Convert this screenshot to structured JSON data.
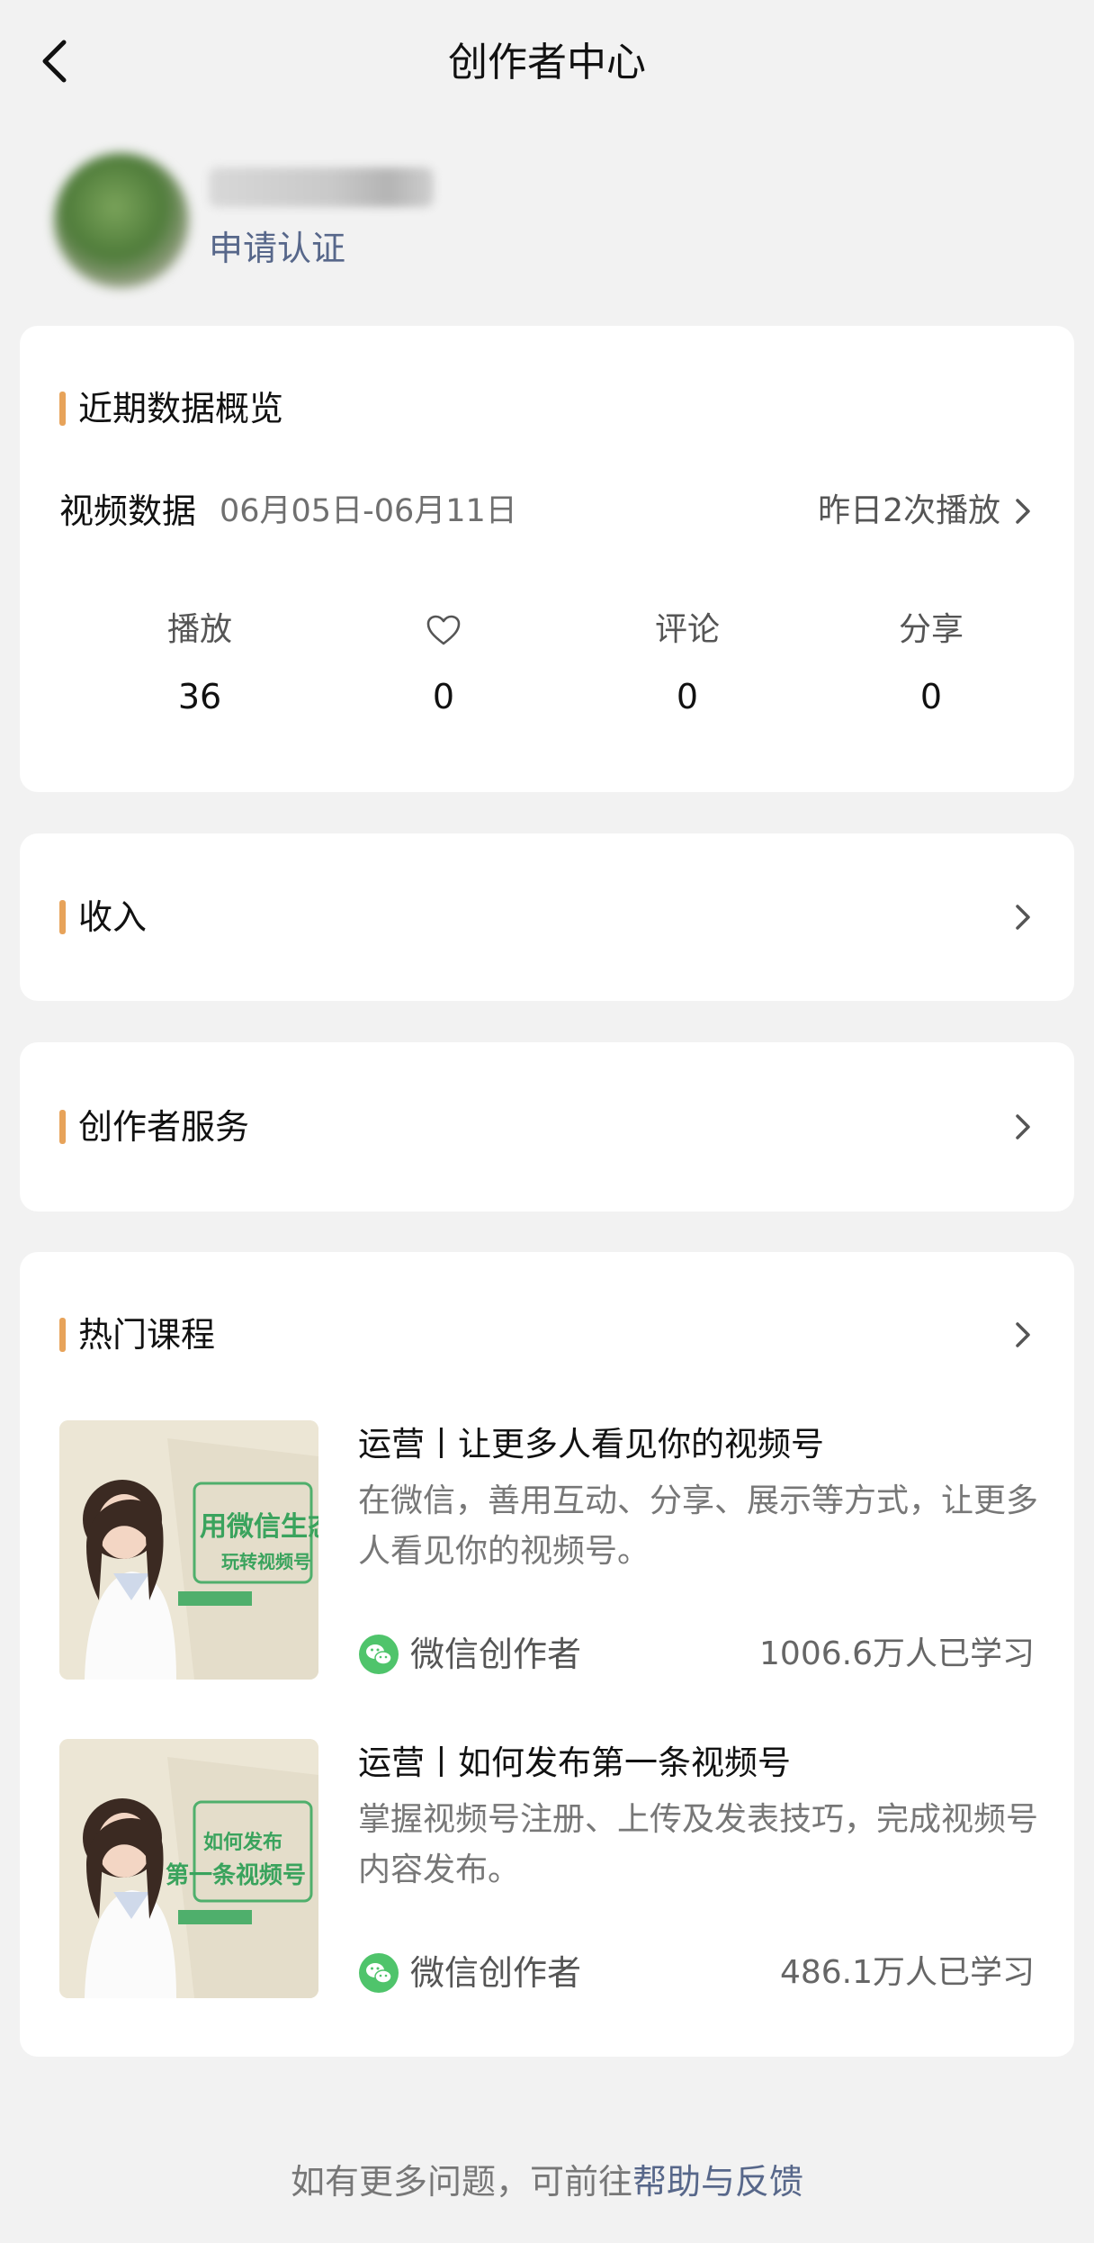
{
  "header": {
    "title": "创作者中心"
  },
  "profile": {
    "apply_cert": "申请认证"
  },
  "overview": {
    "title": "近期数据概览",
    "data_label": "视频数据",
    "date_range": "06月05日-06月11日",
    "yesterday": "昨日2次播放",
    "stats": [
      {
        "label": "播放",
        "value": "36"
      },
      {
        "label": "",
        "icon": "heart-icon",
        "value": "0"
      },
      {
        "label": "评论",
        "value": "0"
      },
      {
        "label": "分享",
        "value": "0"
      }
    ]
  },
  "income": {
    "title": "收入"
  },
  "services": {
    "title": "创作者服务"
  },
  "courses": {
    "title": "热门课程",
    "items": [
      {
        "title": "运营丨让更多人看见你的视频号",
        "desc": "在微信，善用互动、分享、展示等方式，让更多人看见你的视频号。",
        "source": "微信创作者",
        "learners": "1006.6万人已学习",
        "thumb_line1": "用微信生态",
        "thumb_line2": "玩转视频号"
      },
      {
        "title": "运营丨如何发布第一条视频号",
        "desc": "掌握视频号注册、上传及发表技巧，完成视频号内容发布。",
        "source": "微信创作者",
        "learners": "486.1万人已学习",
        "thumb_line1": "如何发布",
        "thumb_line2": "第一条视频号"
      }
    ]
  },
  "footer": {
    "text": "如有更多问题，可前往",
    "link": "帮助与反馈"
  },
  "colors": {
    "accent": "#e7a35a",
    "link": "#57678a",
    "wechat_green": "#4fc46b",
    "background": "#f2f2f2"
  }
}
